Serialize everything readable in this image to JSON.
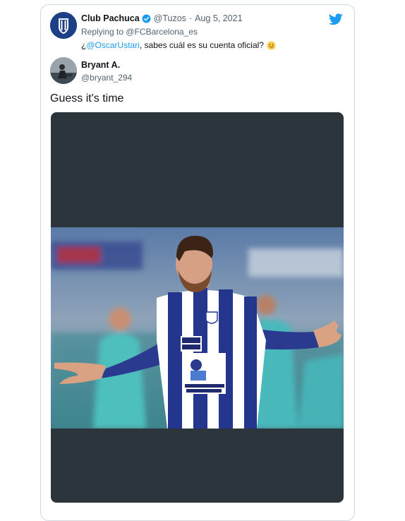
{
  "quoted_tweet": {
    "author_name": "Club Pachuca",
    "author_handle": "@Tuzos",
    "separator": "·",
    "date": "Aug 5, 2021",
    "replying_to_label": "Replying to",
    "replying_to_handle": "@FCBarcelona_es",
    "text_prefix": "¿",
    "mention": "@OscarUstari",
    "text_body": ", sabes cuál es su cuenta oficial?",
    "emoji": "slightly-smiling-face-icon",
    "verified": true
  },
  "tweet": {
    "author_name": "Bryant A.",
    "author_handle": "@bryant_294",
    "text": "Guess it's time"
  },
  "media": {
    "jersey_sponsor_1": "Mobil Super",
    "jersey_sponsor_2": "CEMENTOS FORTALEZA"
  },
  "colors": {
    "link": "#1d9bf0",
    "brand": "#1d9bf0",
    "verified": "#1d9bf0",
    "media_background": "#2d353c",
    "secondary_text": "#536471"
  },
  "icons": [
    "twitter-bird-icon",
    "verified-badge-icon",
    "slightly-smiling-face-icon",
    "club-crest-icon"
  ]
}
